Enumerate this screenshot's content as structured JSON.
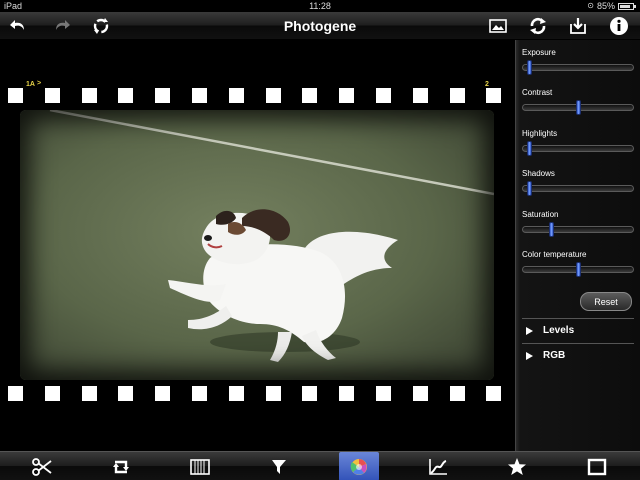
{
  "status_bar": {
    "device": "iPad",
    "time": "11:28",
    "battery": "85%",
    "battery_level": 0.85
  },
  "top_bar": {
    "title": "Photogene",
    "icons": [
      "undo-icon",
      "redo-icon",
      "revert-icon",
      "photo-library-icon",
      "sync-icon",
      "save-icon",
      "info-icon"
    ]
  },
  "canvas": {
    "frame_label_left": "1A",
    "frame_arrow": ">",
    "frame_label_right": "2"
  },
  "adjustments": {
    "sliders": [
      {
        "label": "Exposure",
        "value": 0.05
      },
      {
        "label": "Contrast",
        "value": 0.5
      },
      {
        "label": "Highlights",
        "value": 0.05
      },
      {
        "label": "Shadows",
        "value": 0.05
      },
      {
        "label": "Saturation",
        "value": 0.25
      },
      {
        "label": "Color temperature",
        "value": 0.5
      }
    ],
    "reset_label": "Reset",
    "sections": [
      {
        "label": "Levels"
      },
      {
        "label": "RGB"
      }
    ]
  },
  "bottom_bar": {
    "tools": [
      "crop-icon",
      "rotate-icon",
      "frame-icon",
      "filter-icon",
      "color-wheel-icon",
      "curves-icon",
      "favorites-icon",
      "border-icon"
    ],
    "active_tool": "color-wheel-icon",
    "accent_color": "#3d5fc4"
  },
  "colors": {
    "knob": "#4a74e8",
    "film": "#ffffff",
    "frame_label": "#e8d44a"
  }
}
